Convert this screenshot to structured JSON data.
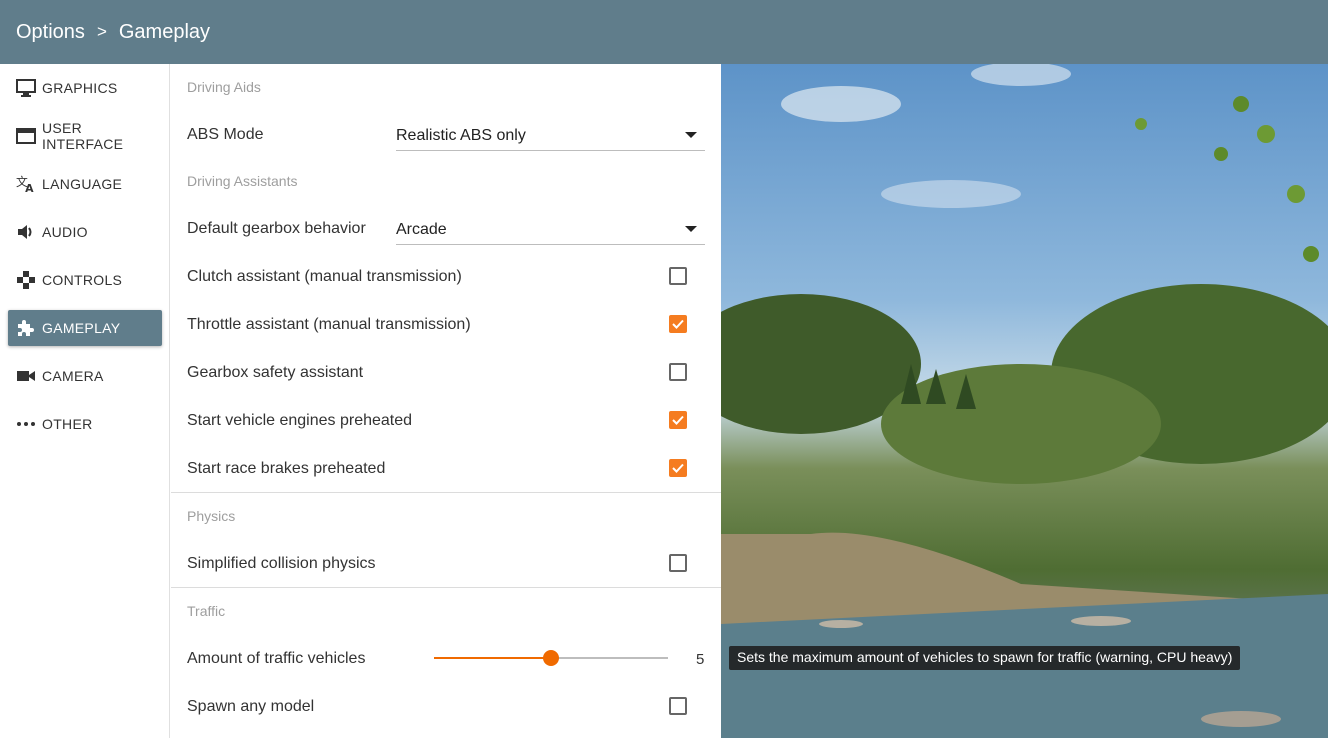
{
  "header": {
    "root": "Options",
    "separator": ">",
    "current": "Gameplay"
  },
  "sidebar": {
    "items": [
      {
        "label": "GRAPHICS",
        "icon": "monitor-icon"
      },
      {
        "label": "USER INTERFACE",
        "icon": "window-icon"
      },
      {
        "label": "LANGUAGE",
        "icon": "translate-icon"
      },
      {
        "label": "AUDIO",
        "icon": "speaker-icon"
      },
      {
        "label": "CONTROLS",
        "icon": "gamepad-icon"
      },
      {
        "label": "GAMEPLAY",
        "icon": "puzzle-icon",
        "active": true
      },
      {
        "label": "CAMERA",
        "icon": "video-camera-icon"
      },
      {
        "label": "OTHER",
        "icon": "more-icon"
      }
    ]
  },
  "sections": {
    "driving_aids": {
      "title": "Driving Aids",
      "abs_mode": {
        "label": "ABS Mode",
        "value": "Realistic ABS only"
      }
    },
    "driving_assistants": {
      "title": "Driving Assistants",
      "gearbox": {
        "label": "Default gearbox behavior",
        "value": "Arcade"
      },
      "options": [
        {
          "label": "Clutch assistant (manual transmission)",
          "checked": false
        },
        {
          "label": "Throttle assistant (manual transmission)",
          "checked": true
        },
        {
          "label": "Gearbox safety assistant",
          "checked": false
        },
        {
          "label": "Start vehicle engines preheated",
          "checked": true
        },
        {
          "label": "Start race brakes preheated",
          "checked": true
        }
      ]
    },
    "physics": {
      "title": "Physics",
      "options": [
        {
          "label": "Simplified collision physics",
          "checked": false
        }
      ]
    },
    "traffic": {
      "title": "Traffic",
      "amount": {
        "label": "Amount of traffic vehicles",
        "value": "5",
        "fraction": 0.5
      },
      "options": [
        {
          "label": "Spawn any model",
          "checked": false
        }
      ]
    }
  },
  "tooltip": "Sets the maximum amount of vehicles to spawn for traffic (warning, CPU heavy)",
  "colors": {
    "header": "#607d8b",
    "accent": "#f57c20",
    "active_nav": "#607d8b"
  }
}
